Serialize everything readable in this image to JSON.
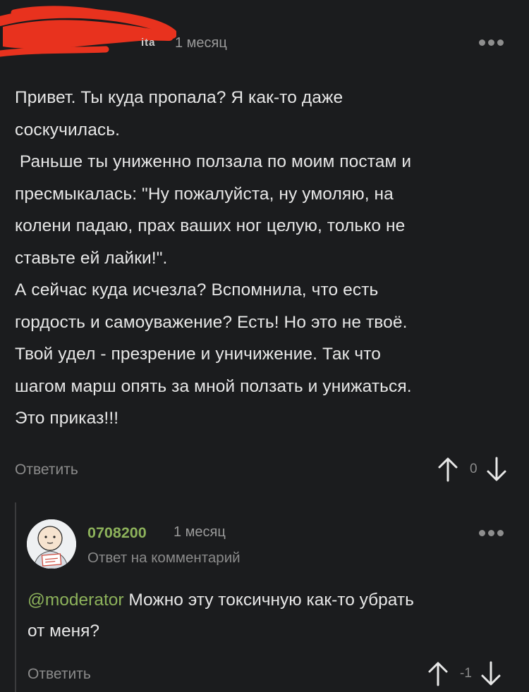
{
  "comment1": {
    "author_tail": "ita",
    "time": "1 месяц",
    "paragraphs": [
      "Привет. Ты куда пропала? Я как-то даже\nсоскучилась.",
      " Раньше ты униженно ползала по моим постам и\nпресмыкалась: \"Ну пожалуйста, ну умоляю, на\nколени падаю, прах ваших ног целую, только не\nставьте ей лайки!\".",
      "А сейчас куда исчезла? Вспомнила, что есть\nгордость и самоуважение? Есть! Но это не твоё.\nТвой удел - презрение и уничижение. Так что\nшагом марш опять за мной ползать и унижаться.\nЭто приказ!!!"
    ],
    "reply_label": "Ответить",
    "score": "0"
  },
  "comment2": {
    "author": "0708200",
    "time": "1 месяц",
    "subtitle": "Ответ на комментарий",
    "mention": "@moderator",
    "text": " Можно эту токсичную как-то убрать\nот меня?",
    "reply_label": "Ответить",
    "score": "-1"
  },
  "colors": {
    "background": "#1b1c1e",
    "text": "#e7e7e7",
    "muted": "#8b8b8b",
    "accent_green": "#8db25b",
    "redaction_red": "#e8321e"
  },
  "icons": [
    "more-options-icon",
    "upvote-arrow-icon",
    "downvote-arrow-icon",
    "user-avatar"
  ]
}
